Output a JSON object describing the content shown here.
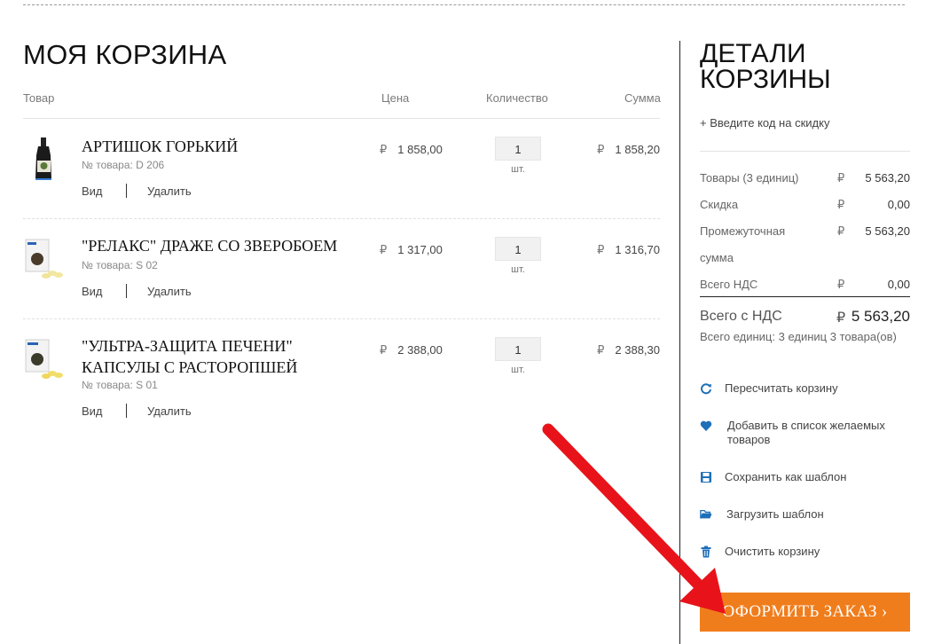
{
  "cart": {
    "title": "МОЯ КОРЗИНА",
    "columns": {
      "product": "Товар",
      "price": "Цена",
      "quantity": "Количество",
      "sum": "Сумма"
    },
    "items": [
      {
        "name": "АРТИШОК ГОРЬКИЙ",
        "article": "№ товара: D 206",
        "currency": "₽",
        "price": "1 858,00",
        "qty": "1",
        "unit": "шт.",
        "sum": "1 858,20",
        "view": "Вид",
        "delete": "Удалить"
      },
      {
        "name": "\"РЕЛАКС\" ДРАЖЕ СО ЗВЕРОБОЕМ",
        "article": "№ товара: S 02",
        "currency": "₽",
        "price": "1 317,00",
        "qty": "1",
        "unit": "шт.",
        "sum": "1 316,70",
        "view": "Вид",
        "delete": "Удалить"
      },
      {
        "name": "\"УЛЬТРА-ЗАЩИТА ПЕЧЕНИ\" КАПСУЛЫ С РАСТОРОПШЕЙ",
        "article": "№ товара: S 01",
        "currency": "₽",
        "price": "2 388,00",
        "qty": "1",
        "unit": "шт.",
        "sum": "2 388,30",
        "view": "Вид",
        "delete": "Удалить"
      }
    ]
  },
  "details": {
    "title": "ДЕТАЛИ КОРЗИНЫ",
    "promo": "+ Введите код на скидку",
    "summary": [
      {
        "label": "Товары (3 единиц)",
        "currency": "₽",
        "value": "5 563,20"
      },
      {
        "label": "Скидка",
        "currency": "₽",
        "value": "0,00"
      },
      {
        "label": "Промежуточная",
        "currency": "₽",
        "value": "5 563,20"
      },
      {
        "label": "сумма",
        "currency": "",
        "value": ""
      },
      {
        "label": "Всего НДС",
        "currency": "₽",
        "value": "0,00"
      }
    ],
    "total_label": "Всего с НДС",
    "total_currency": "₽",
    "total_value": "5 563,20",
    "units_info": "Всего единиц: 3 единиц 3 товара(ов)",
    "actions": {
      "recalc": "Пересчитать корзину",
      "wishlist": "Добавить в список желаемых товаров",
      "save_template": "Сохранить как шаблон",
      "load_template": "Загрузить шаблон",
      "clear": "Очистить корзину"
    },
    "checkout": "ОФОРМИТЬ ЗАКАЗ ›"
  },
  "colors": {
    "accent": "#f07d1c",
    "icon_blue": "#1d6fb8",
    "arrow_red": "#e8131a"
  },
  "icons": [
    "refresh-icon",
    "heart-icon",
    "save-icon",
    "folder-open-icon",
    "trash-icon"
  ]
}
